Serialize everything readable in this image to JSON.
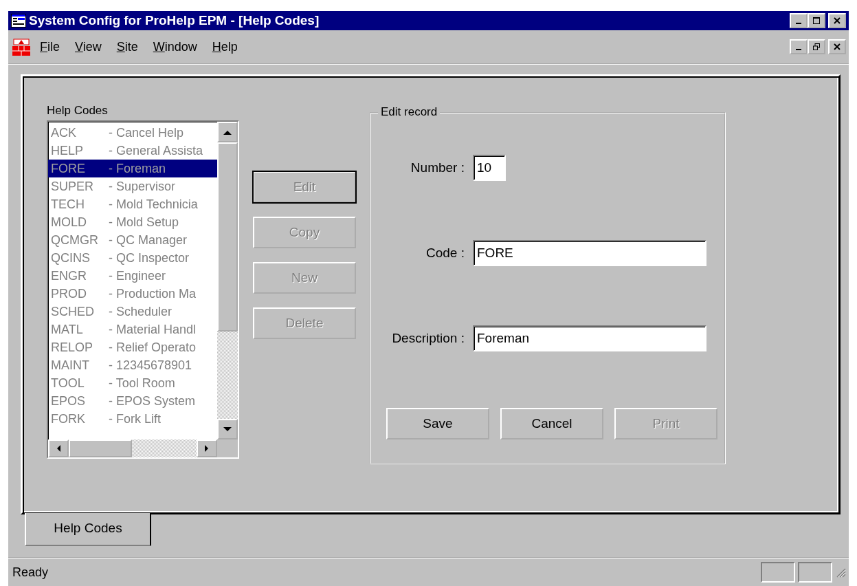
{
  "window": {
    "title": "System Config for ProHelp EPM - [Help Codes]"
  },
  "menu": [
    {
      "label": "File"
    },
    {
      "label": "View"
    },
    {
      "label": "Site"
    },
    {
      "label": "Window"
    },
    {
      "label": "Help"
    }
  ],
  "list": {
    "label": "Help Codes",
    "disabled": true,
    "items": [
      {
        "code": "ACK",
        "description": "- Cancel Help",
        "selected": false
      },
      {
        "code": "HELP",
        "description": "- General Assista",
        "selected": false
      },
      {
        "code": "FORE",
        "description": "- Foreman",
        "selected": true
      },
      {
        "code": "SUPER",
        "description": "- Supervisor",
        "selected": false
      },
      {
        "code": "TECH",
        "description": "- Mold Technicia",
        "selected": false
      },
      {
        "code": "MOLD",
        "description": "- Mold Setup",
        "selected": false
      },
      {
        "code": "QCMGR",
        "description": "- QC Manager",
        "selected": false
      },
      {
        "code": "QCINS",
        "description": "- QC Inspector",
        "selected": false
      },
      {
        "code": "ENGR",
        "description": "- Engineer",
        "selected": false
      },
      {
        "code": "PROD",
        "description": "- Production Ma",
        "selected": false
      },
      {
        "code": "SCHED",
        "description": "- Scheduler",
        "selected": false
      },
      {
        "code": "MATL",
        "description": "- Material Handl",
        "selected": false
      },
      {
        "code": "RELOP",
        "description": "- Relief Operato",
        "selected": false
      },
      {
        "code": "MAINT",
        "description": "- 12345678901",
        "selected": false
      },
      {
        "code": "TOOL",
        "description": "- Tool Room",
        "selected": false
      },
      {
        "code": "EPOS",
        "description": "- EPOS System",
        "selected": false
      },
      {
        "code": "FORK",
        "description": "- Fork Lift",
        "selected": false
      }
    ]
  },
  "actions": [
    {
      "label": "Edit",
      "disabled": true,
      "default": true
    },
    {
      "label": "Copy",
      "disabled": true,
      "default": false
    },
    {
      "label": "New",
      "disabled": true,
      "default": false
    },
    {
      "label": "Delete",
      "disabled": true,
      "default": false
    }
  ],
  "edit_record": {
    "title": "Edit record",
    "fields": [
      {
        "label": "Number :",
        "value": "10",
        "kind": "number"
      },
      {
        "label": "Code :",
        "value": "FORE",
        "kind": "text"
      },
      {
        "label": "Description :",
        "value": "Foreman",
        "kind": "text"
      }
    ],
    "buttons": [
      {
        "label": "Save",
        "disabled": false
      },
      {
        "label": "Cancel",
        "disabled": false
      },
      {
        "label": "Print",
        "disabled": true
      }
    ]
  },
  "tabs": [
    {
      "label": "Help Codes",
      "selected": true
    }
  ],
  "status_bar": {
    "text": "Ready"
  }
}
